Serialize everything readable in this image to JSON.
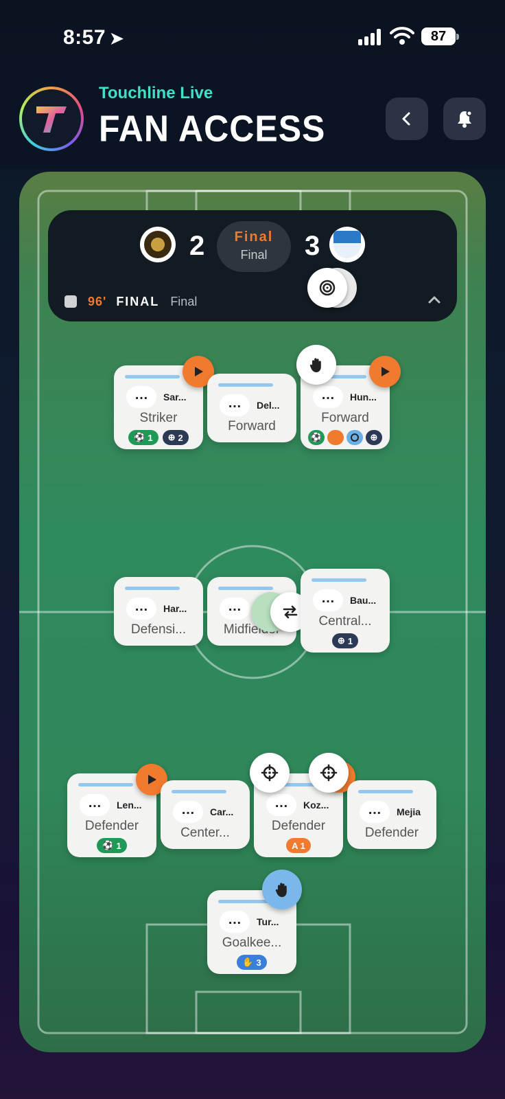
{
  "status": {
    "time": "8:57",
    "battery": "87"
  },
  "header": {
    "brand": "Touchline Live",
    "title": "FAN ACCESS"
  },
  "score": {
    "home_score": "2",
    "away_score": "3",
    "status_primary": "Final",
    "status_secondary": "Final",
    "minute": "96'",
    "period": "FINAL",
    "period_label": "Final"
  },
  "players": [
    {
      "name": "Sar...",
      "position": "Striker",
      "badges": [
        {
          "icon": "ball-icon",
          "value": "1"
        },
        {
          "icon": "crosshair-icon",
          "value": "2"
        }
      ]
    },
    {
      "name": "Del...",
      "position": "Forward",
      "badges": []
    },
    {
      "name": "Hun...",
      "position": "Forward",
      "badges": [
        {
          "icon": "ball-icon",
          "value": ""
        },
        {
          "icon": "orange-dot-icon",
          "value": ""
        },
        {
          "icon": "target-icon",
          "value": ""
        },
        {
          "icon": "crosshair-icon",
          "value": ""
        }
      ]
    },
    {
      "name": "Har...",
      "position": "Defensi...",
      "badges": []
    },
    {
      "name": "",
      "position": "Midfielder",
      "badges": []
    },
    {
      "name": "Bau...",
      "position": "Central...",
      "badges": [
        {
          "icon": "crosshair-icon",
          "value": "1"
        }
      ]
    },
    {
      "name": "Len...",
      "position": "Defender",
      "badges": [
        {
          "icon": "ball-icon",
          "value": "1"
        }
      ]
    },
    {
      "name": "Car...",
      "position": "Center...",
      "badges": []
    },
    {
      "name": "Koz...",
      "position": "Defender",
      "badges": [
        {
          "icon": "assist-icon",
          "value": "A 1"
        }
      ]
    },
    {
      "name": "Mejia",
      "position": "Defender",
      "badges": []
    },
    {
      "name": "Tur...",
      "position": "Goalkee...",
      "badges": [
        {
          "icon": "glove-icon",
          "value": "3"
        }
      ]
    }
  ],
  "colors": {
    "accent": "#f07a2e",
    "brand": "#3ee0c8",
    "pitch": "#2f8a5e"
  }
}
